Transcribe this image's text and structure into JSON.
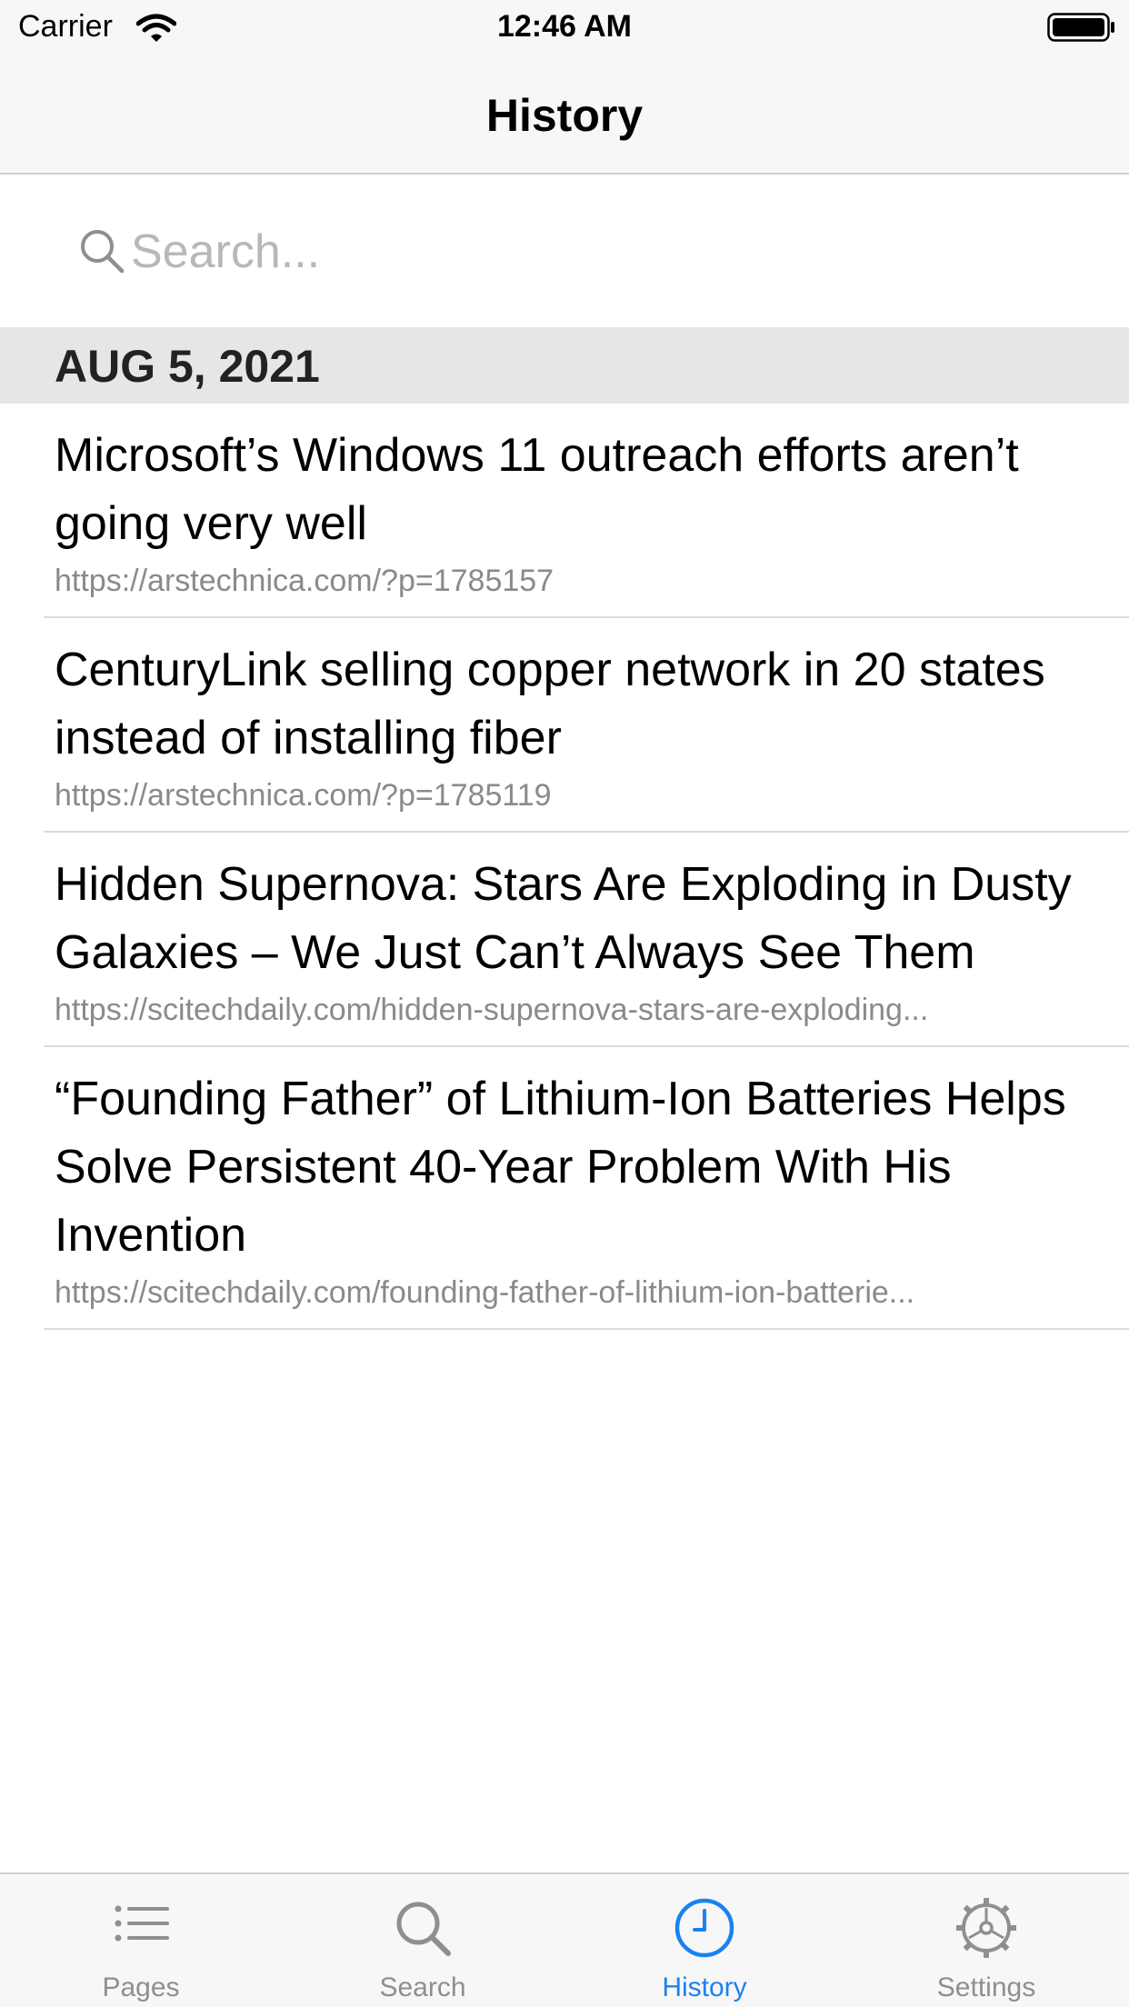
{
  "status_bar": {
    "carrier": "Carrier",
    "time": "12:46 AM",
    "wifi_icon": "wifi-icon",
    "battery_icon": "battery-icon"
  },
  "nav": {
    "title": "History"
  },
  "search": {
    "placeholder": "Search...",
    "value": "",
    "icon": "search-icon"
  },
  "history": {
    "sections": [
      {
        "date": "AUG 5, 2021",
        "items": [
          {
            "title": "Microsoft’s Windows 11 outreach efforts aren’t going very well",
            "url": "https://arstechnica.com/?p=1785157"
          },
          {
            "title": "CenturyLink selling copper network in 20 states instead of installing fiber",
            "url": "https://arstechnica.com/?p=1785119"
          },
          {
            "title": "Hidden Supernova: Stars Are Exploding in Dusty Galaxies – We Just Can’t Always See Them",
            "url": "https://scitechdaily.com/hidden-supernova-stars-are-exploding..."
          },
          {
            "title": "“Founding Father” of Lithium-Ion Batteries Helps Solve Persistent 40-Year Problem With His Invention",
            "url": "https://scitechdaily.com/founding-father-of-lithium-ion-batterie..."
          }
        ]
      }
    ]
  },
  "tab_bar": {
    "accent_color": "#1a82f0",
    "inactive_color": "#8e8e93",
    "tabs": [
      {
        "label": "Pages",
        "icon": "list-icon",
        "active": false
      },
      {
        "label": "Search",
        "icon": "search-icon",
        "active": false
      },
      {
        "label": "History",
        "icon": "clock-icon",
        "active": true
      },
      {
        "label": "Settings",
        "icon": "gear-icon",
        "active": false
      }
    ]
  }
}
